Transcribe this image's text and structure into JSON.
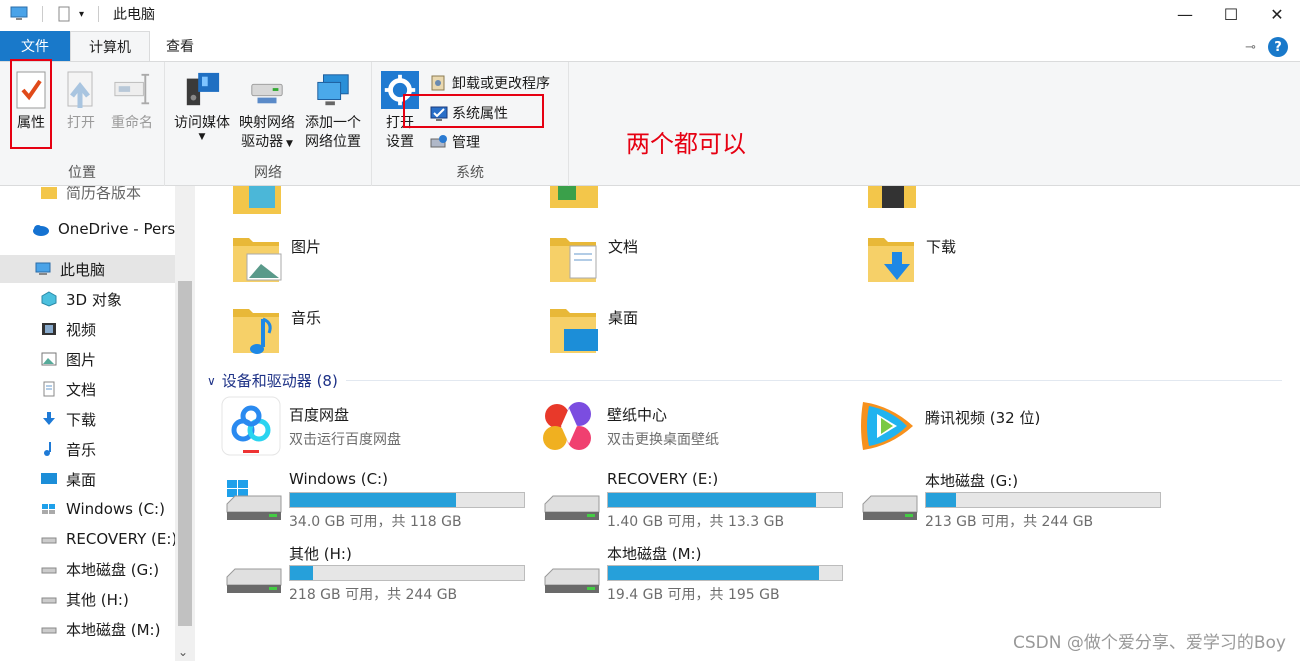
{
  "window": {
    "title": "此电脑"
  },
  "ribbon_tabs": [
    "文件",
    "计算机",
    "查看"
  ],
  "ribbon": {
    "location_group": {
      "label": "位置",
      "properties": "属性",
      "open": "打开",
      "rename": "重命名"
    },
    "network_group": {
      "label": "网络",
      "access_media": "访问媒体",
      "map_drive_1": "映射网络",
      "map_drive_2": "驱动器",
      "add_location_1": "添加一个",
      "add_location_2": "网络位置"
    },
    "system_group": {
      "label": "系统",
      "open_settings_1": "打开",
      "open_settings_2": "设置",
      "uninstall": "卸载或更改程序",
      "system_properties": "系统属性",
      "manage": "管理"
    }
  },
  "annotation": "两个都可以",
  "nav": {
    "partial_top": "简历各版本",
    "onedrive": "OneDrive - Perso",
    "this_pc": "此电脑",
    "items": [
      "3D 对象",
      "视频",
      "图片",
      "文档",
      "下载",
      "音乐",
      "桌面",
      "Windows (C:)",
      "RECOVERY (E:)",
      "本地磁盘 (G:)",
      "其他 (H:)",
      "本地磁盘 (M:)"
    ]
  },
  "folders": [
    "图片",
    "文档",
    "下载",
    "音乐",
    "桌面"
  ],
  "devices_header": "设备和驱动器 (8)",
  "apps": [
    {
      "name": "百度网盘",
      "sub": "双击运行百度网盘"
    },
    {
      "name": "壁纸中心",
      "sub": "双击更换桌面壁纸"
    },
    {
      "name": "腾讯视频 (32 位)",
      "sub": ""
    }
  ],
  "drives": [
    {
      "name": "Windows (C:)",
      "free": "34.0 GB 可用，共 118 GB",
      "used_fraction": 0.71
    },
    {
      "name": "RECOVERY (E:)",
      "free": "1.40 GB 可用，共 13.3 GB",
      "used_fraction": 0.89
    },
    {
      "name": "本地磁盘 (G:)",
      "free": "213 GB 可用，共 244 GB",
      "used_fraction": 0.13
    },
    {
      "name": "其他 (H:)",
      "free": "218 GB 可用，共 244 GB",
      "used_fraction": 0.1
    },
    {
      "name": "本地磁盘 (M:)",
      "free": "19.4 GB 可用，共 195 GB",
      "used_fraction": 0.9
    }
  ],
  "watermark": "CSDN @做个爱分享、爱学习的Boy",
  "colors": {
    "accent": "#1979ca",
    "annotation": "#e60012",
    "bar_fill": "#26a0da"
  }
}
